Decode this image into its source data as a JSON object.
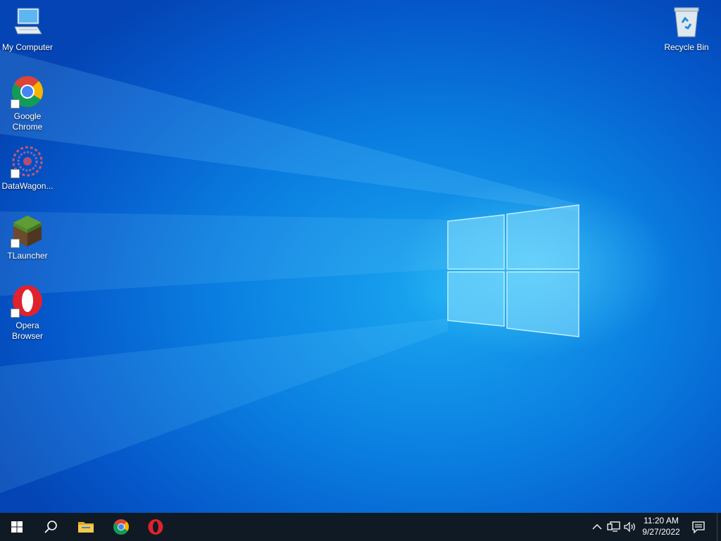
{
  "desktop": {
    "icons": [
      {
        "label": "My Computer",
        "icon": "computer-icon"
      },
      {
        "label": "Google Chrome",
        "icon": "chrome-icon"
      },
      {
        "label": "DataWagon...",
        "icon": "datawagon-icon"
      },
      {
        "label": "TLauncher",
        "icon": "minecraft-grass-block-icon"
      },
      {
        "label": "Opera Browser",
        "icon": "opera-icon"
      },
      {
        "label": "Recycle Bin",
        "icon": "recycle-bin-icon"
      }
    ]
  },
  "taskbar": {
    "pinned": [
      {
        "name": "start-button",
        "icon": "windows-logo-icon"
      },
      {
        "name": "search-button",
        "icon": "search-icon"
      },
      {
        "name": "file-explorer-button",
        "icon": "folder-icon"
      },
      {
        "name": "chrome-taskbar-button",
        "icon": "chrome-icon"
      },
      {
        "name": "opera-taskbar-button",
        "icon": "opera-icon"
      }
    ],
    "tray": {
      "icons": [
        "chevron-up-icon",
        "network-icon",
        "volume-icon"
      ],
      "time": "11:20 AM",
      "date": "9/27/2022",
      "notification_icon": "notification-icon"
    }
  },
  "colors": {
    "taskbar_bg": "#0f1a24",
    "wallpaper_accent": "#0a7ee0"
  }
}
